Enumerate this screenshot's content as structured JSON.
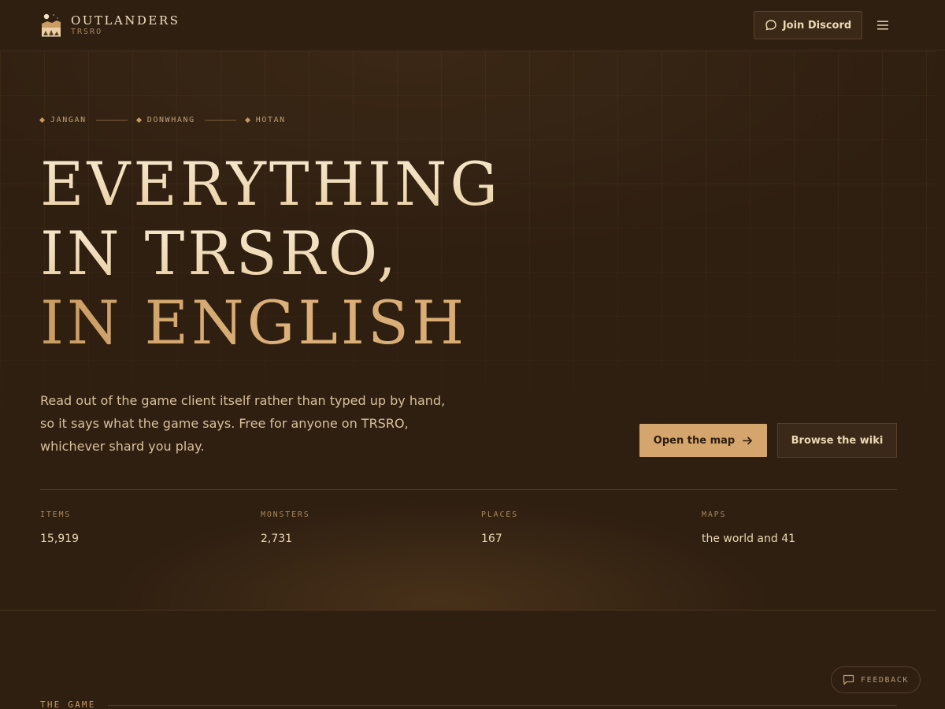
{
  "brand": {
    "name": "OUTLANDERS",
    "subtitle": "TRSRO",
    "logo_icon": "caravan-city-logo"
  },
  "header": {
    "discord_label": "Join Discord",
    "discord_icon": "chat-bubble-icon",
    "menu_icon": "hamburger-menu-icon"
  },
  "hero": {
    "route": [
      "JANGAN",
      "DONWHANG",
      "HOTAN"
    ],
    "headline": {
      "line1": "EVERYTHING",
      "line2": "IN TRSRO,",
      "line3": "IN ENGLISH"
    },
    "lede": "Read out of the game client itself rather than typed up by hand, so it says what the game says. Free for anyone on TRSRO, whichever shard you play.",
    "primary_cta": "Open the map",
    "secondary_cta": "Browse the wiki",
    "stats": [
      {
        "label": "ITEMS",
        "value": "15,919"
      },
      {
        "label": "MONSTERS",
        "value": "2,731"
      },
      {
        "label": "PLACES",
        "value": "167"
      },
      {
        "label": "MAPS",
        "value": "the world and 41"
      }
    ]
  },
  "section": {
    "label": "THE GAME"
  },
  "feedback": {
    "label": "FEEDBACK"
  },
  "colors": {
    "background": "#2f1f11",
    "accent_gold": "#d4a56c",
    "headline_cream": "#f3e3c2",
    "headline_gold": "#c99c63",
    "text_muted": "#a8875e"
  }
}
